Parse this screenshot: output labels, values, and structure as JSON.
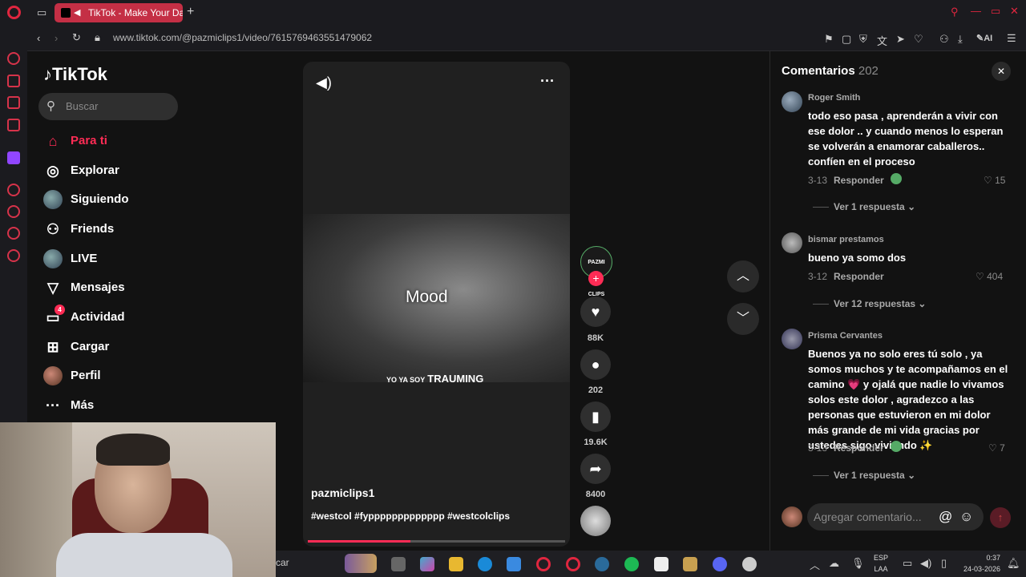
{
  "browser": {
    "tab_title": "TikTok - Make Your Day",
    "url": "www.tiktok.com/@pazmiclips1/video/7615769463551479062",
    "ai_label": "AI"
  },
  "tiktok": {
    "logo": "TikTok",
    "search_placeholder": "Buscar",
    "nav": [
      {
        "label": "Para ti",
        "icon": "home-icon",
        "active": true
      },
      {
        "label": "Explorar",
        "icon": "compass-icon"
      },
      {
        "label": "Siguiendo",
        "icon": "following-avatar-icon"
      },
      {
        "label": "Friends",
        "icon": "friends-icon"
      },
      {
        "label": "LIVE",
        "icon": "live-avatar-icon"
      },
      {
        "label": "Mensajes",
        "icon": "send-icon"
      },
      {
        "label": "Actividad",
        "icon": "activity-icon",
        "badge": "4"
      },
      {
        "label": "Cargar",
        "icon": "upload-icon"
      },
      {
        "label": "Perfil",
        "icon": "profile-avatar-icon"
      },
      {
        "label": "Más",
        "icon": "more-icon"
      }
    ],
    "video": {
      "overlay_text": "Mood",
      "caption_small": "YO YA SOY",
      "caption_big": "TRAUMING",
      "author": "pazmiclips1",
      "hashtags": "#westcol #fyppppppppppppp #westcolclips",
      "progress": 0.4,
      "creator_badge": "PAZMI CLIPS",
      "likes": "88K",
      "comments": "202",
      "saves": "19.6K",
      "shares": "8400"
    },
    "comments_panel": {
      "title": "Comentarios",
      "count": "202",
      "items": [
        {
          "user": "Roger Smith",
          "text": "todo eso pasa , aprenderán a vivir con ese dolor .. y cuando menos lo esperan se volverán a enamorar caballeros.. confíen en el proceso",
          "date": "3-13",
          "reply": "Responder",
          "likes": "15",
          "replies": "Ver 1 respuesta"
        },
        {
          "user": "bismar prestamos",
          "text": "bueno ya somo dos",
          "date": "3-12",
          "reply": "Responder",
          "likes": "404",
          "replies": "Ver 12 respuestas"
        },
        {
          "user": "Prisma Cervantes",
          "text": "Buenos ya no solo eres tú solo , ya somos muchos y te acompañamos en el camino 💗 y ojalá que nadie lo vivamos solos este dolor , agradezco a las personas que estuvieron en mi dolor más grande de mi vida gracias por ustedes sigo viviendo ✨",
          "date": "3-13",
          "reply": "Responder",
          "likes": "7",
          "replies": "Ver 1 respuesta"
        }
      ],
      "input_placeholder": "Agregar comentario..."
    }
  },
  "taskbar": {
    "search_fragment": "car",
    "lang_top": "ESP",
    "lang_bottom": "LAA",
    "time": "0:37",
    "date": "24-03-2026"
  }
}
